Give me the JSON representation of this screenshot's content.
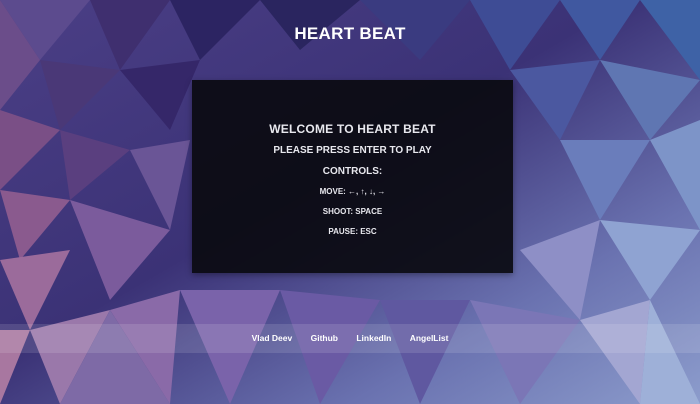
{
  "app": {
    "title": "HEART BEAT"
  },
  "panel": {
    "welcome": "WELCOME TO HEART BEAT",
    "press_enter": "PLEASE PRESS ENTER TO PLAY",
    "controls_heading": "CONTROLS:",
    "move": "MOVE: ←, ↑, ↓, →",
    "shoot": "SHOOT: SPACE",
    "pause": "PAUSE: ESC"
  },
  "footer": {
    "links": [
      {
        "label": "Vlad Deev"
      },
      {
        "label": "Github"
      },
      {
        "label": "LinkedIn"
      },
      {
        "label": "AngelList"
      }
    ]
  },
  "colors": {
    "background_purple": "#5a4a8c",
    "panel": "#0a0a10",
    "text": "#ffffff"
  }
}
